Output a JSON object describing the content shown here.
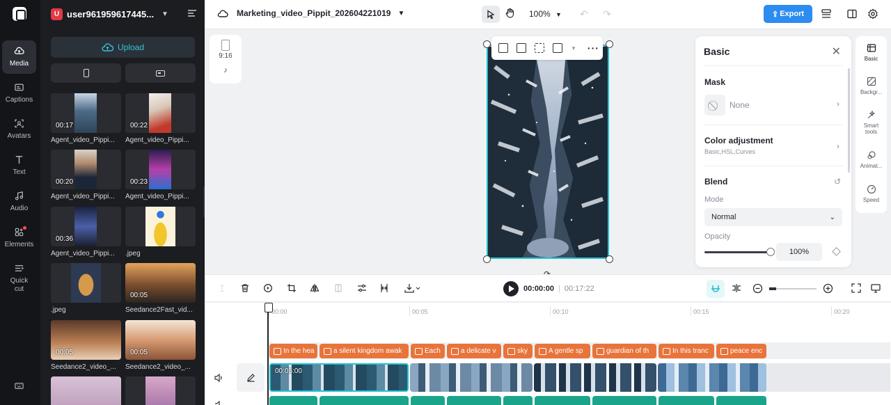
{
  "sidebar": {
    "items": [
      {
        "label": "Media",
        "icon": "cloud-upload-icon",
        "active": true
      },
      {
        "label": "Captions",
        "icon": "captions-icon"
      },
      {
        "label": "Avatars",
        "icon": "avatar-icon"
      },
      {
        "label": "Text",
        "icon": "text-icon"
      },
      {
        "label": "Audio",
        "icon": "music-note-icon"
      },
      {
        "label": "Elements",
        "icon": "elements-icon"
      },
      {
        "label": "Quick cut",
        "icon": "quick-cut-icon"
      }
    ],
    "footer_icon": "keyboard-icon"
  },
  "account": {
    "avatar_letter": "U",
    "username": "user961959617445..."
  },
  "media": {
    "upload_label": "Upload",
    "items": [
      {
        "duration": "00:17",
        "name": "Agent_video_Pippi..."
      },
      {
        "duration": "00:22",
        "name": "Agent_video_Pippi..."
      },
      {
        "duration": "00:20",
        "name": "Agent_video_Pippi..."
      },
      {
        "duration": "00:23",
        "name": "Agent_video_Pippi..."
      },
      {
        "duration": "00:36",
        "name": "Agent_video_Pippi..."
      },
      {
        "duration": "",
        "name": ".jpeg"
      },
      {
        "duration": "",
        "name": ".jpeg"
      },
      {
        "duration": "00:05",
        "name": "Seedance2Fast_vid..."
      },
      {
        "duration": "00:05",
        "name": "Seedance2_video_..."
      },
      {
        "duration": "00:05",
        "name": "Seedance2_video_..."
      },
      {
        "duration": "",
        "name": ""
      },
      {
        "duration": "",
        "name": ""
      }
    ]
  },
  "header": {
    "project_name": "Marketing_video_Pippit_202604221019",
    "zoom": "100%",
    "export_label": "Export"
  },
  "canvas": {
    "aspect_label": "9:16"
  },
  "properties": {
    "title": "Basic",
    "mask_label": "Mask",
    "mask_value": "None",
    "color_adjustment_label": "Color adjustment",
    "color_adjustment_sub": "Basic,HSL,Curves",
    "blend_label": "Blend",
    "mode_label": "Mode",
    "mode_value": "Normal",
    "opacity_label": "Opacity",
    "opacity_value": "100%",
    "opacity_level": 1.0
  },
  "side_tabs": [
    {
      "label": "Basic",
      "icon": "basic-icon"
    },
    {
      "label": "Backgr...",
      "icon": "background-icon"
    },
    {
      "label": "Smart tools",
      "icon": "smart-tools-icon"
    },
    {
      "label": "Animat...",
      "icon": "animation-icon"
    },
    {
      "label": "Speed",
      "icon": "speed-icon"
    }
  ],
  "playback": {
    "current_time": "00:00:00",
    "total_time": "00:17:22"
  },
  "timeline": {
    "ticks": [
      "00:00",
      "00:05",
      "00:10",
      "00:15",
      "00:20"
    ],
    "captions": [
      "In the hea",
      "a silent kingdom awak",
      "Each",
      "a delicate v",
      "sky",
      "A gentle sp",
      "guardian of th",
      "In this tranc",
      "peace enc"
    ],
    "selected_clip_time": "00:05:00"
  },
  "colors": {
    "accent": "#1fc4d0",
    "export": "#2d8cf0",
    "caption": "#e8743b",
    "audio": "#1aa58a"
  }
}
